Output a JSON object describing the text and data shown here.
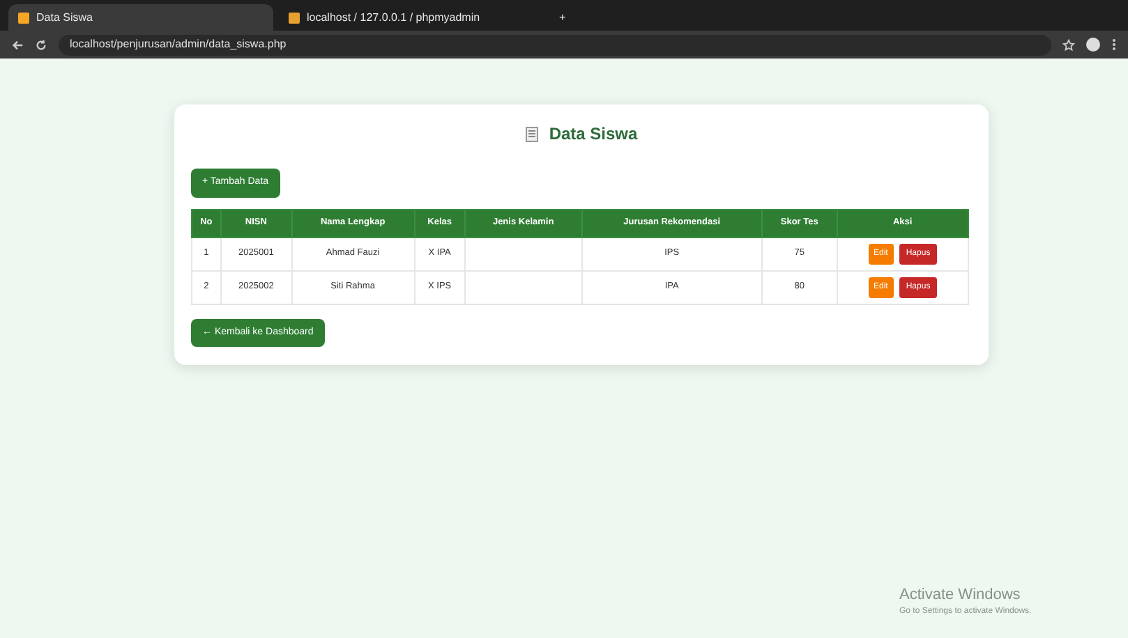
{
  "browser": {
    "tabs": [
      {
        "title": "Data Siswa",
        "selected": true
      },
      {
        "title": "localhost / 127.0.0.1 / phpmyadmin",
        "selected": false
      }
    ],
    "new_tab": "+",
    "url": "localhost/penjurusan/admin/data_siswa.php"
  },
  "page": {
    "title": "Data Siswa",
    "add_button": "+ Tambah Data",
    "table": {
      "columns": [
        "No",
        "NISN",
        "Nama Lengkap",
        "Kelas",
        "Jenis Kelamin",
        "Jurusan Rekomendasi",
        "Skor Tes",
        "Aksi"
      ],
      "rows": [
        {
          "cells": [
            "1",
            "2025001",
            "Ahmad Fauzi",
            "X IPA",
            "",
            "IPS",
            "75"
          ],
          "actions": [
            "Edit",
            "Hapus"
          ]
        },
        {
          "cells": [
            "2",
            "2025002",
            "Siti Rahma",
            "X IPS",
            "",
            "IPA",
            "80"
          ],
          "actions": [
            "Edit",
            "Hapus"
          ]
        }
      ]
    },
    "back_button": "← Kembali ke Dashboard"
  },
  "os_notice": {
    "title": "Activate Windows",
    "text": "Go to Settings to activate Windows."
  }
}
